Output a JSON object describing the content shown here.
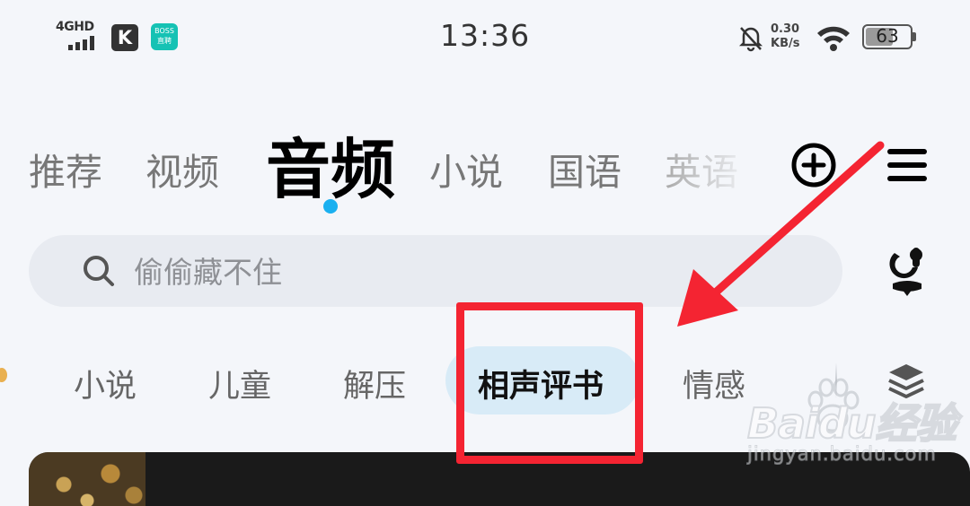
{
  "status_bar": {
    "network": "4GHD",
    "app_k": "K",
    "app_boss_top": "BOSS",
    "app_boss_bottom": "直聘",
    "time": "13:36",
    "speed_value": "0.30",
    "speed_unit": "KB/s",
    "battery": "63",
    "battery_level": 0.63
  },
  "top_tabs": [
    {
      "label": "推荐"
    },
    {
      "label": "视频"
    },
    {
      "label": "音频",
      "active": true
    },
    {
      "label": "小说"
    },
    {
      "label": "国语"
    },
    {
      "label": "英语"
    }
  ],
  "search": {
    "placeholder": "偷偷藏不住"
  },
  "sub_tabs": [
    {
      "label": "小说"
    },
    {
      "label": "儿童"
    },
    {
      "label": "解压"
    },
    {
      "label": "相声评书",
      "active": true
    },
    {
      "label": "情感"
    }
  ],
  "watermark": {
    "brand": "Baidu经验",
    "url": "jingyan.baidu.com"
  },
  "colors": {
    "accent_dot": "#1ab0f0",
    "active_subtab_bg": "#d8ebf7",
    "annotation_red": "#f42432"
  },
  "icons": {
    "add": "plus-circle-icon",
    "menu": "hamburger-menu-icon",
    "search": "search-icon",
    "mic": "voice-assistant-icon",
    "more_categories": "layers-icon"
  }
}
